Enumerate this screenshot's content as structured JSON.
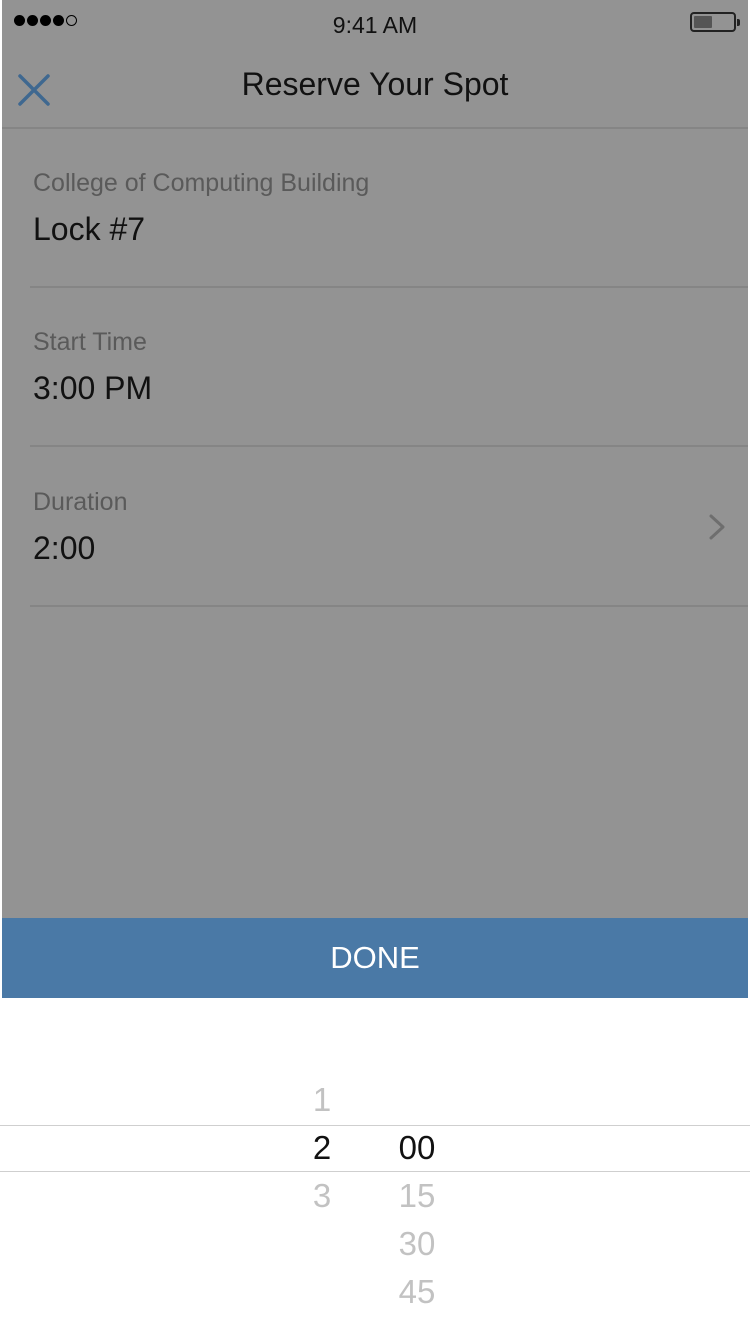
{
  "status_bar": {
    "time": "9:41 AM",
    "signal_bars_filled": 4,
    "signal_bars_total": 5,
    "battery_level": 0.45
  },
  "nav": {
    "title": "Reserve Your Spot",
    "close_icon": "close-icon",
    "accent_color": "#4a6d92"
  },
  "rows": [
    {
      "label": "College of Computing Building",
      "value": "Lock #7"
    },
    {
      "label": "Start Time",
      "value": "3:00 PM"
    },
    {
      "label": "Duration",
      "value": "2:00",
      "icon": "chevron-right-icon"
    }
  ],
  "done_button": {
    "label": "DONE",
    "color": "#4a79a6"
  },
  "picker": {
    "hours": [
      "1",
      "2",
      "3"
    ],
    "selected_hour": "2",
    "minutes": [
      "00",
      "15",
      "30",
      "45"
    ],
    "selected_minute": "00"
  }
}
